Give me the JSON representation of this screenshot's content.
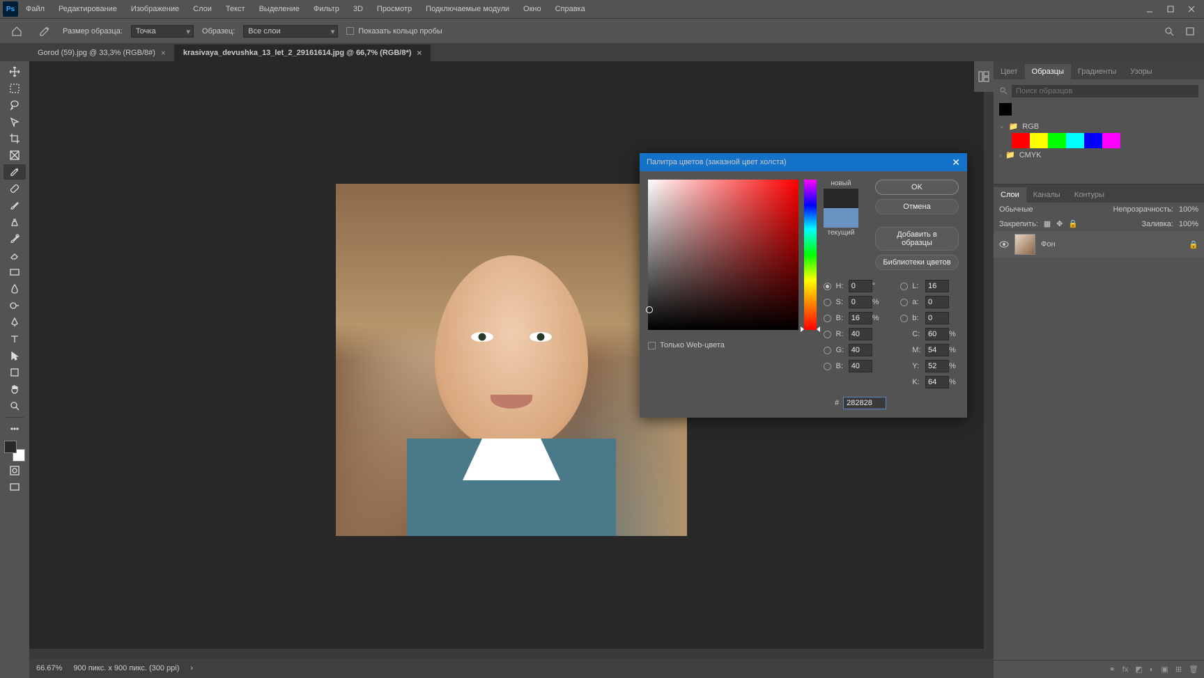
{
  "menubar": {
    "logo": "Ps",
    "items": [
      "Файл",
      "Редактирование",
      "Изображение",
      "Слои",
      "Текст",
      "Выделение",
      "Фильтр",
      "3D",
      "Просмотр",
      "Подключаемые модули",
      "Окно",
      "Справка"
    ]
  },
  "optionsbar": {
    "sample_size_label": "Размер образца:",
    "sample_size_value": "Точка",
    "sample_label": "Образец:",
    "sample_value": "Все слои",
    "show_ring": "Показать кольцо пробы"
  },
  "tabs": [
    {
      "label": "Gorod  (59).jpg @ 33,3% (RGB/8#)",
      "active": false
    },
    {
      "label": "krasivaya_devushka_13_let_2_29161614.jpg @ 66,7% (RGB/8*)",
      "active": true
    }
  ],
  "status": {
    "zoom": "66.67%",
    "info": "900 пикс. x 900 пикс. (300 ppi)"
  },
  "panels": {
    "top_tabs": [
      "Цвет",
      "Образцы",
      "Градиенты",
      "Узоры"
    ],
    "top_active": "Образцы",
    "search_placeholder": "Поиск образцов",
    "folders": [
      {
        "name": "RGB",
        "open": true,
        "colors": [
          "#ff0000",
          "#ffff00",
          "#00ff00",
          "#00ffff",
          "#0000ff",
          "#ff00ff"
        ]
      },
      {
        "name": "CMYK",
        "open": false
      }
    ],
    "layers_tabs": [
      "Слои",
      "Каналы",
      "Контуры"
    ],
    "layers_active": "Слои",
    "blend_mode": "Обычные",
    "opacity_label": "Непрозрачность:",
    "opacity": "100%",
    "lock_label": "Закрепить:",
    "fill_label": "Заливка:",
    "fill": "100%",
    "layer_name": "Фон"
  },
  "color_picker": {
    "title": "Палитра цветов (заказной цвет холста)",
    "new_label": "новый",
    "current_label": "текущий",
    "btn_ok": "OK",
    "btn_cancel": "Отмена",
    "btn_add": "Добавить в образцы",
    "btn_libs": "Библиотеки цветов",
    "web_only": "Только Web-цвета",
    "fields": {
      "H": {
        "label": "H:",
        "val": "0",
        "unit": "°"
      },
      "S": {
        "label": "S:",
        "val": "0",
        "unit": "%"
      },
      "Bv": {
        "label": "B:",
        "val": "16",
        "unit": "%"
      },
      "R": {
        "label": "R:",
        "val": "40",
        "unit": ""
      },
      "G": {
        "label": "G:",
        "val": "40",
        "unit": ""
      },
      "Bc": {
        "label": "B:",
        "val": "40",
        "unit": ""
      },
      "L": {
        "label": "L:",
        "val": "16",
        "unit": ""
      },
      "a": {
        "label": "a:",
        "val": "0",
        "unit": ""
      },
      "b": {
        "label": "b:",
        "val": "0",
        "unit": ""
      },
      "C": {
        "label": "C:",
        "val": "60",
        "unit": "%"
      },
      "M": {
        "label": "M:",
        "val": "54",
        "unit": "%"
      },
      "Y": {
        "label": "Y:",
        "val": "52",
        "unit": "%"
      },
      "K": {
        "label": "K:",
        "val": "64",
        "unit": "%"
      }
    },
    "hex_label": "#",
    "hex": "282828"
  }
}
